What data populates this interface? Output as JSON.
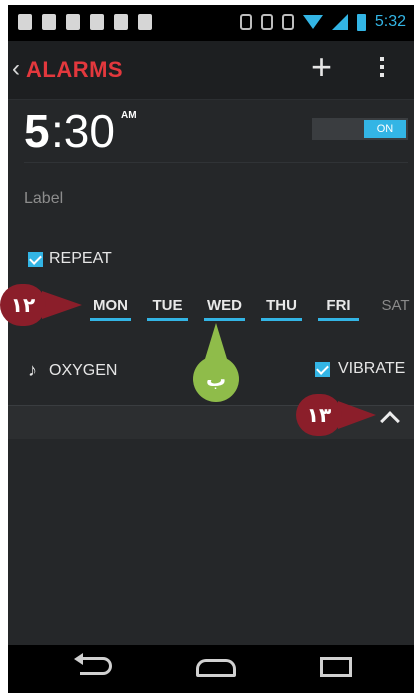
{
  "status_bar": {
    "time": "5:32"
  },
  "action_bar": {
    "title": "ALARMS"
  },
  "alarm": {
    "time_hour": "5",
    "time_minutes": ":30",
    "ampm": "AM",
    "toggle_state": "ON",
    "label_placeholder": "Label",
    "repeat_label": "REPEAT",
    "days": [
      {
        "label": "MON",
        "active": true
      },
      {
        "label": "TUE",
        "active": true
      },
      {
        "label": "WED",
        "active": true
      },
      {
        "label": "THU",
        "active": true
      },
      {
        "label": "FRI",
        "active": true
      },
      {
        "label": "SAT",
        "active": false
      }
    ],
    "ringtone": "OXYGEN",
    "vibrate_label": "VIBRATE"
  },
  "callouts": {
    "marker_12": "١٢",
    "marker_13": "١٣",
    "marker_b": "ب"
  },
  "colors": {
    "accent": "#33b5e5",
    "title_red": "#e3383d",
    "callout_red": "#8b1e2a",
    "callout_green": "#8fbc4a"
  }
}
